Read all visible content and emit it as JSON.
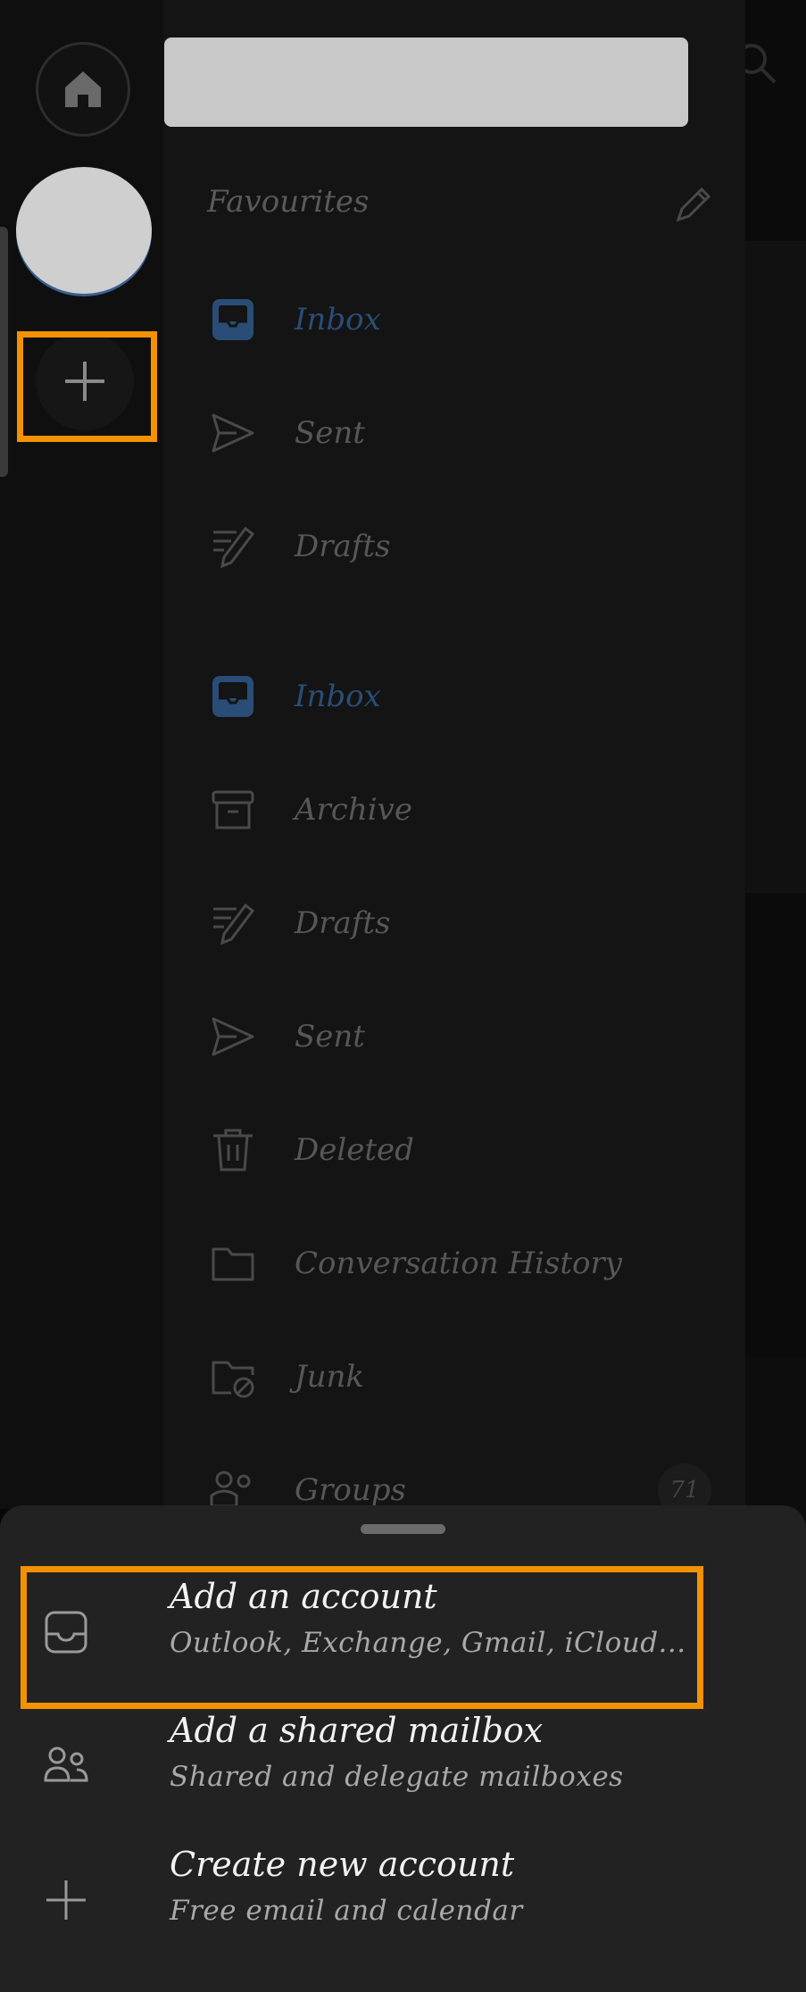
{
  "rail": {
    "home_icon": "home-icon",
    "add_icon": "plus-icon"
  },
  "drawer": {
    "favourites_title": "Favourites",
    "favourites": [
      {
        "label": "Inbox",
        "icon": "inbox-icon",
        "active": true
      },
      {
        "label": "Sent",
        "icon": "send-icon"
      },
      {
        "label": "Drafts",
        "icon": "drafts-icon"
      }
    ],
    "folders": [
      {
        "label": "Inbox",
        "icon": "inbox-icon",
        "active": true
      },
      {
        "label": "Archive",
        "icon": "archive-icon"
      },
      {
        "label": "Drafts",
        "icon": "drafts-icon"
      },
      {
        "label": "Sent",
        "icon": "send-icon"
      },
      {
        "label": "Deleted",
        "icon": "trash-icon"
      },
      {
        "label": "Conversation History",
        "icon": "folder-icon"
      },
      {
        "label": "Junk",
        "icon": "junk-folder-icon"
      },
      {
        "label": "Groups",
        "icon": "groups-icon",
        "badge": "71"
      }
    ]
  },
  "sheet": {
    "options": [
      {
        "title": "Add an account",
        "subtitle": "Outlook, Exchange, Gmail, iCloud...",
        "icon": "inbox-tray-icon"
      },
      {
        "title": "Add a shared mailbox",
        "subtitle": "Shared and delegate mailboxes",
        "icon": "people-icon"
      },
      {
        "title": "Create new account",
        "subtitle": "Free email and calendar",
        "icon": "plus-icon"
      }
    ]
  },
  "colors": {
    "highlight": "#f39200",
    "active_folder": "#2a4d77",
    "sheet_bg": "#222222"
  }
}
